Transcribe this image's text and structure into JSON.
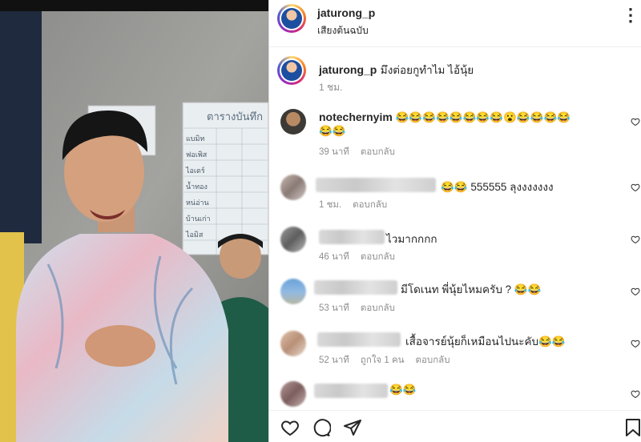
{
  "post": {
    "username": "jaturong_p",
    "audio_label": "เสียงต้นฉบับ",
    "more_label": "⋮"
  },
  "caption": {
    "username": "jaturong_p",
    "text": "มึงต่อยกูทำไม ไอ้นุ้ย",
    "time": "1 ชม."
  },
  "comments": [
    {
      "username": "notechernyim",
      "text": "😂😂😂😂😂😂😂😂😮😂😂😂😂",
      "text2": "😂😂",
      "time": "39 นาที",
      "likes": "",
      "reply": "ตอบกลับ"
    },
    {
      "username": "",
      "text": "😂😂 555555 ลุงงงงงงง",
      "time": "1 ชม.",
      "likes": "",
      "reply": "ตอบกลับ"
    },
    {
      "username": "",
      "text": "ไวมากกกก",
      "time": "46 นาที",
      "likes": "",
      "reply": "ตอบกลับ"
    },
    {
      "username": "",
      "text": "มีโดเนท พี่นุ้ยไหมครับ ? 😂😂",
      "time": "53 นาที",
      "likes": "",
      "reply": "ตอบกลับ"
    },
    {
      "username": "",
      "text": "เสื้อจารย์นุ้ยก็เหมือนไปนะคับ😂😂",
      "time": "52 นาที",
      "likes": "ถูกใจ 1 คน",
      "reply": "ตอบกลับ"
    },
    {
      "username": "",
      "text": "😂😂",
      "time": "",
      "likes": "",
      "reply": ""
    }
  ],
  "colors": {
    "ig_gradient": [
      "#feda75",
      "#fa7e1e",
      "#d62976",
      "#962fbf",
      "#4f5bd5"
    ],
    "text": "#262626",
    "muted": "#8e8e8e"
  },
  "icons": [
    "more-options-icon",
    "heart-icon",
    "comment-icon",
    "share-icon",
    "bookmark-icon"
  ]
}
